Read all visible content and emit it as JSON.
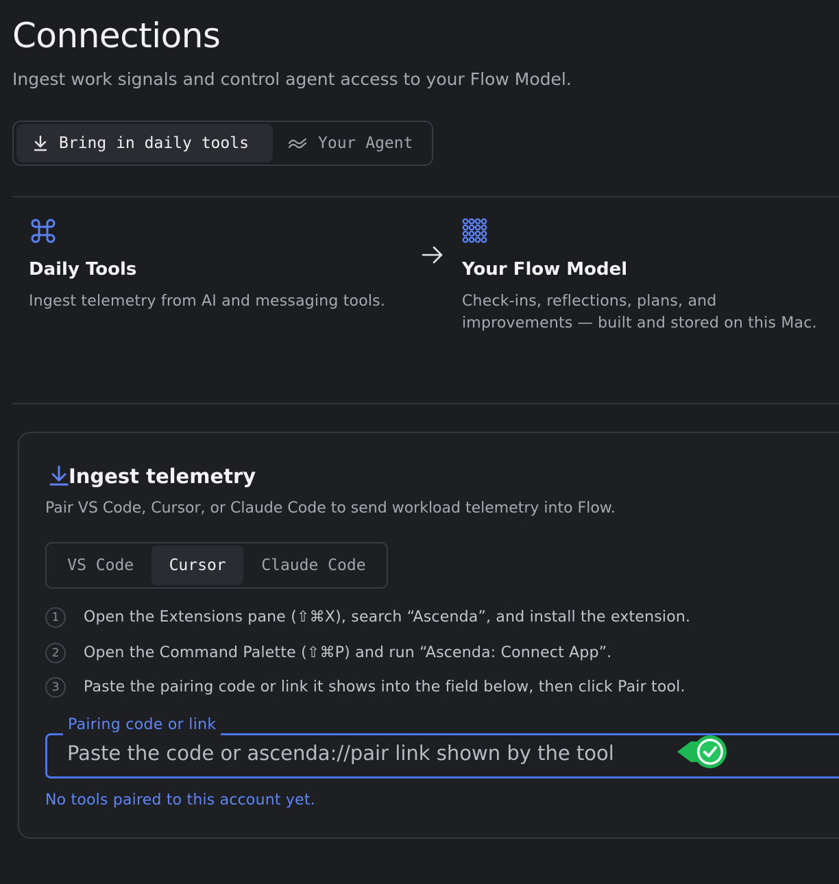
{
  "header": {
    "title": "Connections",
    "subtitle": "Ingest work signals and control agent access to your Flow Model."
  },
  "top_tabs": [
    {
      "label": "Bring in daily tools",
      "icon": "download-arrow-icon",
      "active": true
    },
    {
      "label": "Your Agent",
      "icon": "wave-icon",
      "active": false
    }
  ],
  "flow": {
    "source": {
      "icon": "command-key-icon",
      "title": "Daily Tools",
      "description": "Ingest telemetry from AI and messaging tools."
    },
    "arrow_icon": "arrow-right-icon",
    "target": {
      "icon": "dot-grid-icon",
      "title": "Your Flow Model",
      "description_line1": "Check-ins, reflections, plans, and",
      "description_line2": "improvements — built and stored on this Mac."
    }
  },
  "ingest": {
    "icon": "download-arrow-icon",
    "title": "Ingest telemetry",
    "description": "Pair VS Code, Cursor, or Claude Code to send workload telemetry into Flow.",
    "tools": [
      {
        "label": "VS Code",
        "active": false
      },
      {
        "label": "Cursor",
        "active": true
      },
      {
        "label": "Claude Code",
        "active": false
      }
    ],
    "steps": [
      {
        "num": "1",
        "text": "Open the Extensions pane (⇧⌘X), search “Ascenda”, and install the extension."
      },
      {
        "num": "2",
        "text": "Open the Command Palette (⇧⌘P) and run “Ascenda: Connect App”."
      },
      {
        "num": "3",
        "text": "Paste the pairing code or link it shows into the field below, then click Pair tool."
      }
    ],
    "field_label": "Pairing code or link",
    "field_placeholder": "Paste the code or ascenda://pair link shown by the tool",
    "field_value": "",
    "status": "No tools paired to this account yet."
  },
  "colors": {
    "background": "#1c1d21",
    "accent": "#4b74f0",
    "badge_green": "#1db954"
  }
}
